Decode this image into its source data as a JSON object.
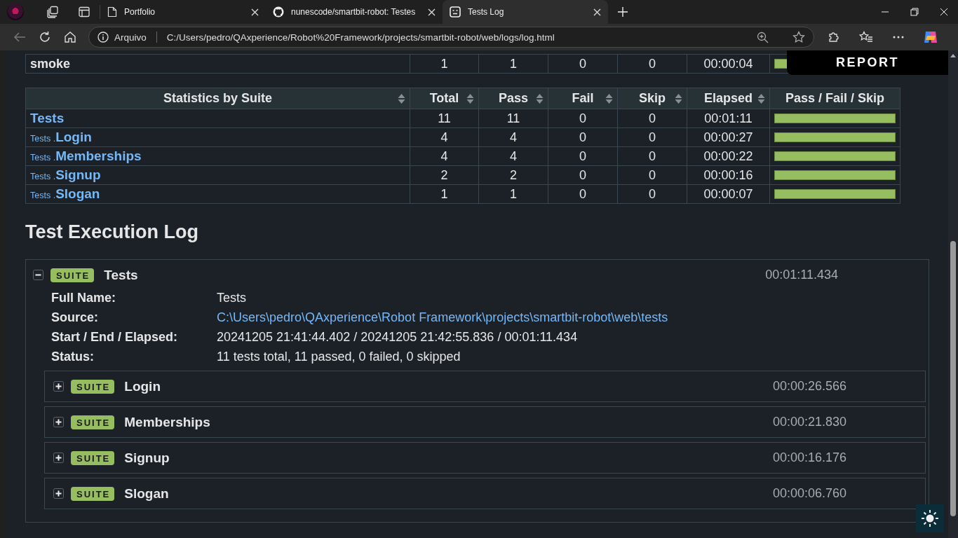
{
  "browser": {
    "tabs": [
      {
        "title": "Portfolio",
        "kind": "page",
        "selected": false
      },
      {
        "title": "nunescode/smartbit-robot: Testes",
        "kind": "github",
        "selected": false
      },
      {
        "title": "Tests Log",
        "kind": "robot",
        "selected": true
      }
    ],
    "address": {
      "scheme_label": "Arquivo",
      "url": "C:/Users/pedro/QAxperience/Robot%20Framework/projects/smartbit-robot/web/logs/log.html"
    }
  },
  "report_link": "REPORT",
  "tag_stats": {
    "rows": [
      {
        "name": "smoke",
        "total": "1",
        "pass": "1",
        "fail": "0",
        "skip": "0",
        "elapsed": "00:00:04",
        "level": 1
      }
    ]
  },
  "suite_stats": {
    "columns": [
      "Statistics by Suite",
      "Total",
      "Pass",
      "Fail",
      "Skip",
      "Elapsed",
      "Pass / Fail / Skip"
    ],
    "rows": [
      {
        "prefix": "",
        "name": "Tests",
        "total": "11",
        "pass": "11",
        "fail": "0",
        "skip": "0",
        "elapsed": "00:01:11",
        "level": 1
      },
      {
        "prefix": "Tests .",
        "name": "Login",
        "total": "4",
        "pass": "4",
        "fail": "0",
        "skip": "0",
        "elapsed": "00:00:27",
        "level": 1
      },
      {
        "prefix": "Tests .",
        "name": "Memberships",
        "total": "4",
        "pass": "4",
        "fail": "0",
        "skip": "0",
        "elapsed": "00:00:22",
        "level": 1
      },
      {
        "prefix": "Tests .",
        "name": "Signup",
        "total": "2",
        "pass": "2",
        "fail": "0",
        "skip": "0",
        "elapsed": "00:00:16",
        "level": 1
      },
      {
        "prefix": "Tests .",
        "name": "Slogan",
        "total": "1",
        "pass": "1",
        "fail": "0",
        "skip": "0",
        "elapsed": "00:00:07",
        "level": 1
      }
    ]
  },
  "log": {
    "title": "Test Execution Log",
    "suite": {
      "type": "SUITE",
      "name": "Tests",
      "elapsed": "00:01:11.434",
      "expanded": true,
      "metadata": [
        {
          "label": "Full Name:",
          "value": "Tests",
          "kind": "text"
        },
        {
          "label": "Source:",
          "value": "C:\\Users\\pedro\\QAxperience\\Robot Framework\\projects\\smartbit-robot\\web\\tests",
          "kind": "link"
        },
        {
          "label": "Start / End / Elapsed:",
          "value": "20241205 21:41:44.402 / 20241205 21:42:55.836 / 00:01:11.434",
          "kind": "text"
        },
        {
          "label": "Status:",
          "value": "11 tests total, 11 passed, 0 failed, 0 skipped",
          "kind": "text"
        }
      ],
      "children": [
        {
          "type": "SUITE",
          "name": "Login",
          "elapsed": "00:00:26.566",
          "expanded": false
        },
        {
          "type": "SUITE",
          "name": "Memberships",
          "elapsed": "00:00:21.830",
          "expanded": false
        },
        {
          "type": "SUITE",
          "name": "Signup",
          "elapsed": "00:00:16.176",
          "expanded": false
        },
        {
          "type": "SUITE",
          "name": "Slogan",
          "elapsed": "00:00:06.760",
          "expanded": false
        }
      ]
    }
  }
}
